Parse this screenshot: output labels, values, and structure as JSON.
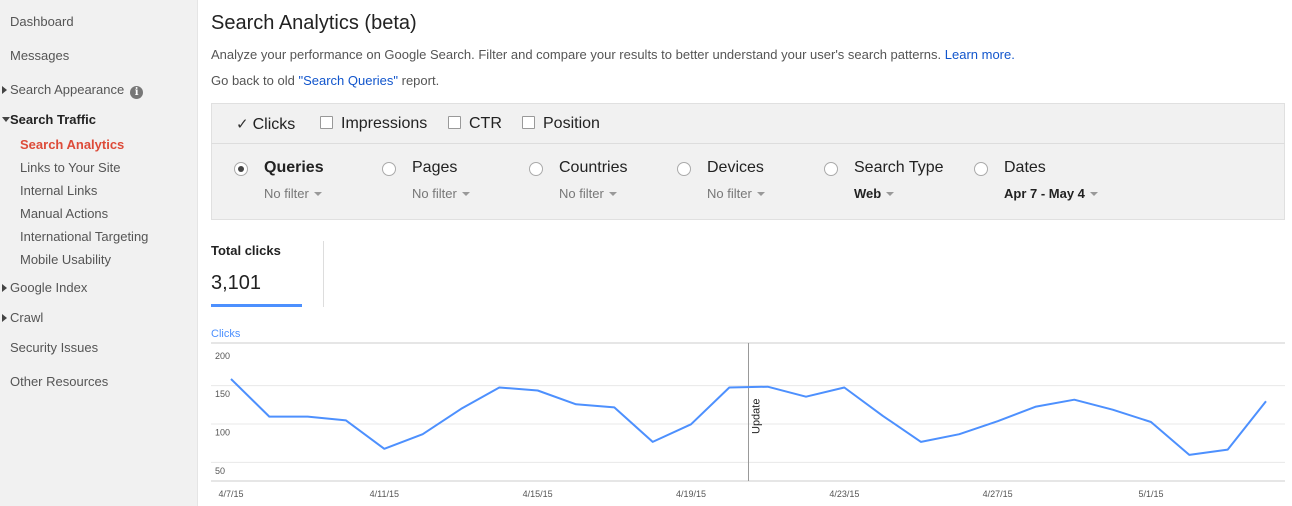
{
  "sidebar": {
    "dashboard": "Dashboard",
    "messages": "Messages",
    "search_appearance": "Search Appearance",
    "search_traffic": "Search Traffic",
    "search_traffic_items": [
      "Search Analytics",
      "Links to Your Site",
      "Internal Links",
      "Manual Actions",
      "International Targeting",
      "Mobile Usability"
    ],
    "google_index": "Google Index",
    "crawl": "Crawl",
    "security_issues": "Security Issues",
    "other_resources": "Other Resources",
    "info_icon": "i"
  },
  "header": {
    "title": "Search Analytics (beta)",
    "description": "Analyze your performance on Google Search. Filter and compare your results to better understand your user's search patterns.",
    "learn_more": "Learn more.",
    "back_prefix": "Go back to old ",
    "back_link": "\"Search Queries\"",
    "back_suffix": " report."
  },
  "metrics": [
    {
      "label": "Clicks",
      "checked": true
    },
    {
      "label": "Impressions",
      "checked": false
    },
    {
      "label": "CTR",
      "checked": false
    },
    {
      "label": "Position",
      "checked": false
    }
  ],
  "checkmark": "✓",
  "dimensions": [
    {
      "label": "Queries",
      "filter": "No filter",
      "selected": true
    },
    {
      "label": "Pages",
      "filter": "No filter",
      "selected": false
    },
    {
      "label": "Countries",
      "filter": "No filter",
      "selected": false
    },
    {
      "label": "Devices",
      "filter": "No filter",
      "selected": false
    },
    {
      "label": "Search Type",
      "filter": "Web",
      "selected": false
    },
    {
      "label": "Dates",
      "filter": "Apr 7 - May 4",
      "selected": false
    }
  ],
  "totals": {
    "label": "Total clicks",
    "value": "3,101"
  },
  "colors": {
    "accent": "#4d90fe",
    "link": "#1155cc",
    "active_nav": "#dd4b39"
  },
  "chart_data": {
    "type": "line",
    "ylabel": "Clicks",
    "ylim": [
      25,
      205
    ],
    "yticks": [
      50,
      100,
      150,
      200
    ],
    "x_tick_labels": [
      "4/7/15",
      "4/11/15",
      "4/15/15",
      "4/19/15",
      "4/23/15",
      "4/27/15",
      "5/1/15"
    ],
    "x_tick_index": [
      0,
      4,
      8,
      12,
      16,
      20,
      24
    ],
    "x_count": 28,
    "annotation": {
      "label": "Update",
      "index": 14
    },
    "series": [
      {
        "values": [
          158,
          109,
          109,
          104,
          67,
          86,
          119,
          147,
          143,
          125,
          121,
          76,
          99,
          147,
          148,
          135,
          147,
          110,
          76,
          86,
          103,
          122,
          131,
          118,
          102,
          59,
          66,
          129
        ]
      }
    ]
  }
}
